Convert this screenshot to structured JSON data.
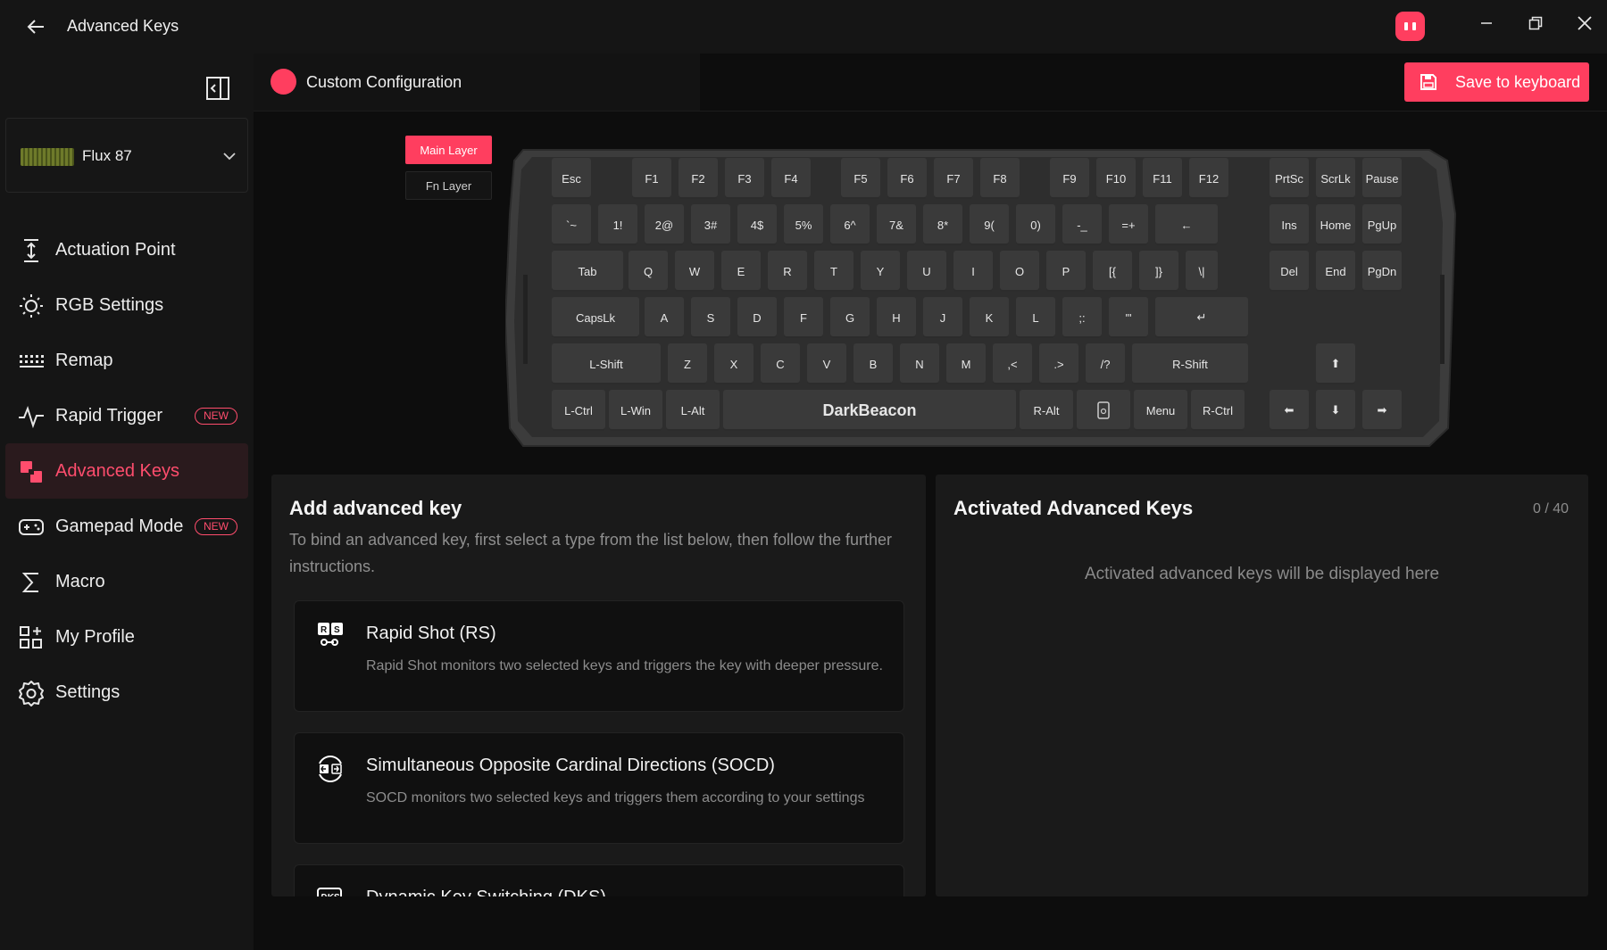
{
  "app": {
    "title": "Advanced Keys"
  },
  "sidebar": {
    "device": {
      "name": "Flux 87"
    },
    "items": [
      {
        "label": "Actuation Point",
        "icon": "actuation-icon",
        "badge": ""
      },
      {
        "label": "RGB Settings",
        "icon": "sun-icon",
        "badge": ""
      },
      {
        "label": "Remap",
        "icon": "keyboard-icon",
        "badge": ""
      },
      {
        "label": "Rapid Trigger",
        "icon": "pulse-icon",
        "badge": "NEW"
      },
      {
        "label": "Advanced Keys",
        "icon": "advanced-keys-icon",
        "badge": ""
      },
      {
        "label": "Gamepad Mode",
        "icon": "gamepad-icon",
        "badge": "NEW"
      },
      {
        "label": "Macro",
        "icon": "sigma-icon",
        "badge": ""
      },
      {
        "label": "My Profile",
        "icon": "grid-plus-icon",
        "badge": ""
      },
      {
        "label": "Settings",
        "icon": "gear-icon",
        "badge": ""
      }
    ]
  },
  "config": {
    "name": "Custom Configuration"
  },
  "toolbar": {
    "save_label": "Save to keyboard"
  },
  "layers": {
    "main": "Main Layer",
    "fn": "Fn Layer"
  },
  "keyboard": {
    "keys": [
      "Esc",
      "F1",
      "F2",
      "F3",
      "F4",
      "F5",
      "F6",
      "F7",
      "F8",
      "F9",
      "F10",
      "F11",
      "F12",
      "PrtSc",
      "ScrLk",
      "Pause",
      "`~",
      "1!",
      "2@",
      "3#",
      "4$",
      "5%",
      "6^",
      "7&",
      "8*",
      "9(",
      "0)",
      "-_",
      "=+",
      "←",
      "Ins",
      "Home",
      "PgUp",
      "Tab",
      "Q",
      "W",
      "E",
      "R",
      "T",
      "Y",
      "U",
      "I",
      "O",
      "P",
      "[{",
      "]}",
      "\\|",
      "Del",
      "End",
      "PgDn",
      "CapsLk",
      "A",
      "S",
      "D",
      "F",
      "G",
      "H",
      "J",
      "K",
      "L",
      ";:",
      "'\"",
      "↵",
      "L-Shift",
      "Z",
      "X",
      "C",
      "V",
      "B",
      "N",
      "M",
      ",<",
      ".>",
      "/?",
      "R-Shift",
      "⬆",
      "L-Ctrl",
      "L-Win",
      "L-Alt",
      "DarkBeacon",
      "R-Alt",
      "",
      "Menu",
      "R-Ctrl",
      "⬅",
      "⬇",
      "➡"
    ]
  },
  "add_panel": {
    "title": "Add advanced key",
    "description": "To bind an advanced key, first select a type from the list below, then follow the further instructions.",
    "cards": [
      {
        "title": "Rapid Shot (RS)",
        "desc": "Rapid Shot monitors two selected keys and triggers the key with deeper pressure."
      },
      {
        "title": "Simultaneous Opposite Cardinal Directions (SOCD)",
        "desc": "SOCD monitors two selected keys and triggers them according to your settings"
      },
      {
        "title": "Dynamic Key Switching (DKS)",
        "desc": ""
      }
    ]
  },
  "activated_panel": {
    "title": "Activated Advanced Keys",
    "count": "0 / 40",
    "empty_text": "Activated advanced keys will be displayed here"
  },
  "colors": {
    "accent": "#ff3e5f",
    "background": "#0d0d0d",
    "panel": "#1a1a1a"
  }
}
